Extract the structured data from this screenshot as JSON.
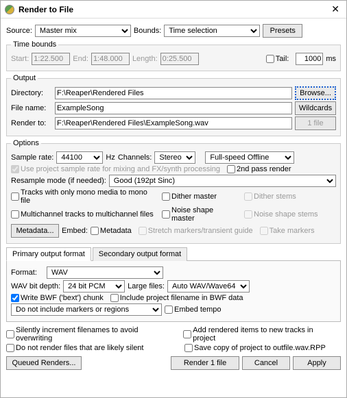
{
  "title": "Render to File",
  "top": {
    "source_lbl": "Source:",
    "source_value": "Master mix",
    "bounds_lbl": "Bounds:",
    "bounds_value": "Time selection",
    "presets_btn": "Presets"
  },
  "time_bounds": {
    "legend": "Time bounds",
    "start_lbl": "Start:",
    "start_val": "1:22.500",
    "end_lbl": "End:",
    "end_val": "1:48.000",
    "length_lbl": "Length:",
    "length_val": "0:25.500",
    "tail_lbl": "Tail:",
    "tail_val": "1000",
    "tail_units": "ms"
  },
  "output": {
    "legend": "Output",
    "dir_lbl": "Directory:",
    "dir_val": "F:\\Reaper\\Rendered Files",
    "browse_btn": "Browse...",
    "file_lbl": "File name:",
    "file_val": "ExampleSong",
    "wildcards_btn": "Wildcards",
    "render_to_lbl": "Render to:",
    "render_to_val": "F:\\Reaper\\Rendered Files\\ExampleSong.wav",
    "count_btn": "1 file"
  },
  "options": {
    "legend": "Options",
    "sample_rate_lbl": "Sample rate:",
    "sample_rate_val": "44100",
    "hz_lbl": "Hz",
    "channels_lbl": "Channels:",
    "channels_val": "Stereo",
    "speed_val": "Full-speed Offline",
    "use_project_sr": "Use project sample rate for mixing and FX/synth processing",
    "second_pass": "2nd pass render",
    "resample_lbl": "Resample mode (if needed):",
    "resample_val": "Good (192pt Sinc)",
    "mono_tracks": "Tracks with only mono media to mono file",
    "dither_master": "Dither master",
    "dither_stems": "Dither stems",
    "multichannel": "Multichannel tracks to multichannel files",
    "noise_master": "Noise shape master",
    "noise_stems": "Noise shape stems",
    "metadata_btn": "Metadata...",
    "embed_lbl": "Embed:",
    "embed_metadata": "Metadata",
    "stretch_markers": "Stretch markers/transient guide",
    "take_markers": "Take markers"
  },
  "tabs": {
    "primary": "Primary output format",
    "secondary": "Secondary output format"
  },
  "format": {
    "format_lbl": "Format:",
    "format_val": "WAV",
    "bitdepth_lbl": "WAV bit depth:",
    "bitdepth_val": "24 bit PCM",
    "large_lbl": "Large files:",
    "large_val": "Auto WAV/Wave64",
    "write_bwf": "Write BWF ('bext') chunk",
    "include_filename": "Include project filename in BWF data",
    "markers_val": "Do not include markers or regions",
    "embed_tempo": "Embed tempo"
  },
  "bottom_opts": {
    "silent_inc": "Silently increment filenames to avoid overwriting",
    "add_items": "Add rendered items to new tracks in project",
    "no_silent": "Do not render files that are likely silent",
    "save_copy": "Save copy of project to outfile.wav.RPP"
  },
  "buttons": {
    "queued": "Queued Renders...",
    "render": "Render 1 file",
    "cancel": "Cancel",
    "apply": "Apply"
  }
}
